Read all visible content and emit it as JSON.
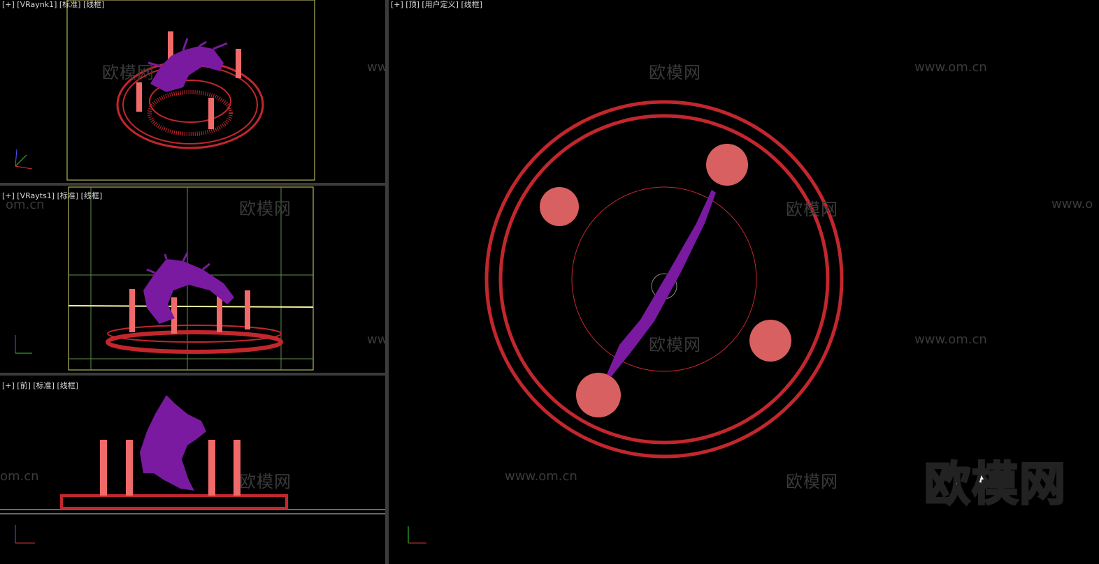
{
  "viewports": {
    "top_left": {
      "label": "[+] [VRaynk1] [标准] [线框]"
    },
    "mid_left": {
      "label": "[+] [VRayts1] [标准] [线框]"
    },
    "bottom_left": {
      "label": "[+] [前] [标准] [线框]"
    },
    "right": {
      "label": "[+] [顶] [用户定义] [线框]"
    }
  },
  "watermarks": {
    "brand_cn": "欧模网",
    "site": "www.om.cn",
    "site_partial_1": "om.cn",
    "site_partial_2": "www.o"
  },
  "logo": "欧模网",
  "axis": {
    "x": "x",
    "y": "y",
    "z": "z"
  },
  "colors": {
    "ring": "#c1272d",
    "particles": "#f06a6a",
    "sculpture": "#7a1aa0",
    "frame": "#d6d66a",
    "divider": "#3b3b3b"
  }
}
